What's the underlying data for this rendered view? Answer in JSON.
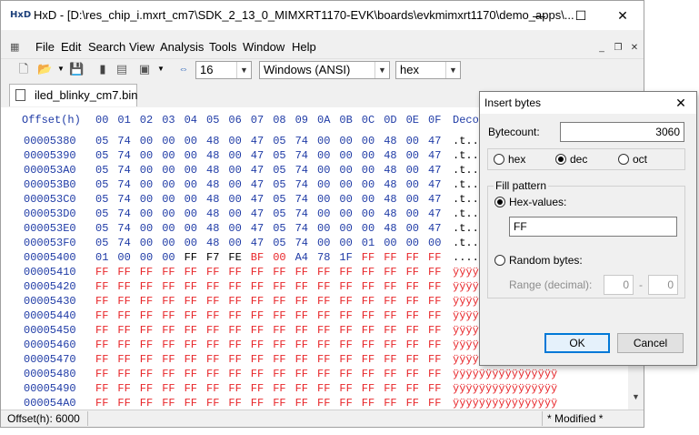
{
  "window": {
    "title": "HxD - [D:\\res_chip_i.mxrt_cm7\\SDK_2_13_0_MIMXRT1170-EVK\\boards\\evkmimxrt1170\\demo_apps\\...",
    "app_icon_text": "HxD",
    "minimize": "—",
    "maximize": "☐",
    "close": "✕"
  },
  "menu": {
    "items": [
      "File",
      "Edit",
      "Search",
      "View",
      "Analysis",
      "Tools",
      "Window",
      "Help"
    ],
    "mdi_minimize": "_",
    "mdi_restore": "❐",
    "mdi_close": "✕"
  },
  "toolbar": {
    "bytes_per_row": "16",
    "charset": "Windows (ANSI)",
    "offset_base": "hex"
  },
  "tab": {
    "label": "iled_blinky_cm7.bin"
  },
  "hex": {
    "offset_header": "Offset(h)",
    "col_headers": [
      "00",
      "01",
      "02",
      "03",
      "04",
      "05",
      "06",
      "07",
      "08",
      "09",
      "0A",
      "0B",
      "0C",
      "0D",
      "0E",
      "0F"
    ],
    "decoded_header": "Decoded text",
    "rows": [
      {
        "addr": "00005380",
        "bytes": [
          "05",
          "74",
          "00",
          "00",
          "00",
          "48",
          "00",
          "47",
          "05",
          "74",
          "00",
          "00",
          "00",
          "48",
          "00",
          "47"
        ],
        "text": ".t...H.G.t...H.G"
      },
      {
        "addr": "00005390",
        "bytes": [
          "05",
          "74",
          "00",
          "00",
          "00",
          "48",
          "00",
          "47",
          "05",
          "74",
          "00",
          "00",
          "00",
          "48",
          "00",
          "47"
        ],
        "text": ".t...H.G.t...H.G"
      },
      {
        "addr": "000053A0",
        "bytes": [
          "05",
          "74",
          "00",
          "00",
          "00",
          "48",
          "00",
          "47",
          "05",
          "74",
          "00",
          "00",
          "00",
          "48",
          "00",
          "47"
        ],
        "text": ".t...H.G.t...H.G"
      },
      {
        "addr": "000053B0",
        "bytes": [
          "05",
          "74",
          "00",
          "00",
          "00",
          "48",
          "00",
          "47",
          "05",
          "74",
          "00",
          "00",
          "00",
          "48",
          "00",
          "47"
        ],
        "text": ".t...H.G.t...H.G"
      },
      {
        "addr": "000053C0",
        "bytes": [
          "05",
          "74",
          "00",
          "00",
          "00",
          "48",
          "00",
          "47",
          "05",
          "74",
          "00",
          "00",
          "00",
          "48",
          "00",
          "47"
        ],
        "text": ".t...H.G.t...H.G"
      },
      {
        "addr": "000053D0",
        "bytes": [
          "05",
          "74",
          "00",
          "00",
          "00",
          "48",
          "00",
          "47",
          "05",
          "74",
          "00",
          "00",
          "00",
          "48",
          "00",
          "47"
        ],
        "text": ".t...H.G.t...H.G"
      },
      {
        "addr": "000053E0",
        "bytes": [
          "05",
          "74",
          "00",
          "00",
          "00",
          "48",
          "00",
          "47",
          "05",
          "74",
          "00",
          "00",
          "00",
          "48",
          "00",
          "47"
        ],
        "text": ".t...H.G.t...H.G"
      },
      {
        "addr": "000053F0",
        "bytes": [
          "05",
          "74",
          "00",
          "00",
          "00",
          "48",
          "00",
          "47",
          "05",
          "74",
          "00",
          "00",
          "01",
          "00",
          "00",
          "00"
        ],
        "text": ".t...H.G.t......"
      },
      {
        "addr": "00005400",
        "bytes": [
          "01",
          "00",
          "00",
          "00",
          "FF",
          "F7",
          "FE",
          "BF",
          "00",
          "A4",
          "78",
          "1F",
          "FF",
          "FF",
          "FF",
          "FF"
        ],
        "text": "....ÿ÷þ¿.¤x.ÿÿÿÿ"
      },
      {
        "addr": "00005410",
        "bytes": [
          "FF",
          "FF",
          "FF",
          "FF",
          "FF",
          "FF",
          "FF",
          "FF",
          "FF",
          "FF",
          "FF",
          "FF",
          "FF",
          "FF",
          "FF",
          "FF"
        ],
        "text": "ÿÿÿÿÿÿÿÿÿÿÿÿÿÿÿÿ"
      },
      {
        "addr": "00005420",
        "bytes": [
          "FF",
          "FF",
          "FF",
          "FF",
          "FF",
          "FF",
          "FF",
          "FF",
          "FF",
          "FF",
          "FF",
          "FF",
          "FF",
          "FF",
          "FF",
          "FF"
        ],
        "text": "ÿÿÿÿÿÿÿÿÿÿÿÿÿÿÿÿ"
      },
      {
        "addr": "00005430",
        "bytes": [
          "FF",
          "FF",
          "FF",
          "FF",
          "FF",
          "FF",
          "FF",
          "FF",
          "FF",
          "FF",
          "FF",
          "FF",
          "FF",
          "FF",
          "FF",
          "FF"
        ],
        "text": "ÿÿÿÿÿÿÿÿÿÿÿÿÿÿÿÿ"
      },
      {
        "addr": "00005440",
        "bytes": [
          "FF",
          "FF",
          "FF",
          "FF",
          "FF",
          "FF",
          "FF",
          "FF",
          "FF",
          "FF",
          "FF",
          "FF",
          "FF",
          "FF",
          "FF",
          "FF"
        ],
        "text": "ÿÿÿÿÿÿÿÿÿÿÿÿÿÿÿÿ"
      },
      {
        "addr": "00005450",
        "bytes": [
          "FF",
          "FF",
          "FF",
          "FF",
          "FF",
          "FF",
          "FF",
          "FF",
          "FF",
          "FF",
          "FF",
          "FF",
          "FF",
          "FF",
          "FF",
          "FF"
        ],
        "text": "ÿÿÿÿÿÿÿÿÿÿÿÿÿÿÿÿ"
      },
      {
        "addr": "00005460",
        "bytes": [
          "FF",
          "FF",
          "FF",
          "FF",
          "FF",
          "FF",
          "FF",
          "FF",
          "FF",
          "FF",
          "FF",
          "FF",
          "FF",
          "FF",
          "FF",
          "FF"
        ],
        "text": "ÿÿÿÿÿÿÿÿÿÿÿÿÿÿÿÿ"
      },
      {
        "addr": "00005470",
        "bytes": [
          "FF",
          "FF",
          "FF",
          "FF",
          "FF",
          "FF",
          "FF",
          "FF",
          "FF",
          "FF",
          "FF",
          "FF",
          "FF",
          "FF",
          "FF",
          "FF"
        ],
        "text": "ÿÿÿÿÿÿÿÿÿÿÿÿÿÿÿÿ"
      },
      {
        "addr": "00005480",
        "bytes": [
          "FF",
          "FF",
          "FF",
          "FF",
          "FF",
          "FF",
          "FF",
          "FF",
          "FF",
          "FF",
          "FF",
          "FF",
          "FF",
          "FF",
          "FF",
          "FF"
        ],
        "text": "ÿÿÿÿÿÿÿÿÿÿÿÿÿÿÿÿ"
      },
      {
        "addr": "00005490",
        "bytes": [
          "FF",
          "FF",
          "FF",
          "FF",
          "FF",
          "FF",
          "FF",
          "FF",
          "FF",
          "FF",
          "FF",
          "FF",
          "FF",
          "FF",
          "FF",
          "FF"
        ],
        "text": "ÿÿÿÿÿÿÿÿÿÿÿÿÿÿÿÿ"
      },
      {
        "addr": "000054A0",
        "bytes": [
          "FF",
          "FF",
          "FF",
          "FF",
          "FF",
          "FF",
          "FF",
          "FF",
          "FF",
          "FF",
          "FF",
          "FF",
          "FF",
          "FF",
          "FF",
          "FF"
        ],
        "text": "ÿÿÿÿÿÿÿÿÿÿÿÿÿÿÿÿ"
      }
    ]
  },
  "status": {
    "offset": "Offset(h): 6000",
    "mode": "* Modified *"
  },
  "colors": {
    "address_blue": "#1f3ba6",
    "inserted_red": "#e8262a",
    "default_button_border": "#0078d7"
  },
  "dialog": {
    "title": "Insert bytes",
    "close": "✕",
    "bytecount_label": "Bytecount:",
    "bytecount_value": "3060",
    "radix_options": [
      "hex",
      "dec",
      "oct"
    ],
    "radix_selected": "dec",
    "fill_pattern_label": "Fill pattern",
    "hex_values_label": "Hex-values:",
    "hex_values_value": "FF",
    "random_bytes_label": "Random bytes:",
    "range_label": "Range (decimal):",
    "range_from": "0",
    "range_sep": "-",
    "range_to": "0",
    "ok": "OK",
    "cancel": "Cancel"
  }
}
